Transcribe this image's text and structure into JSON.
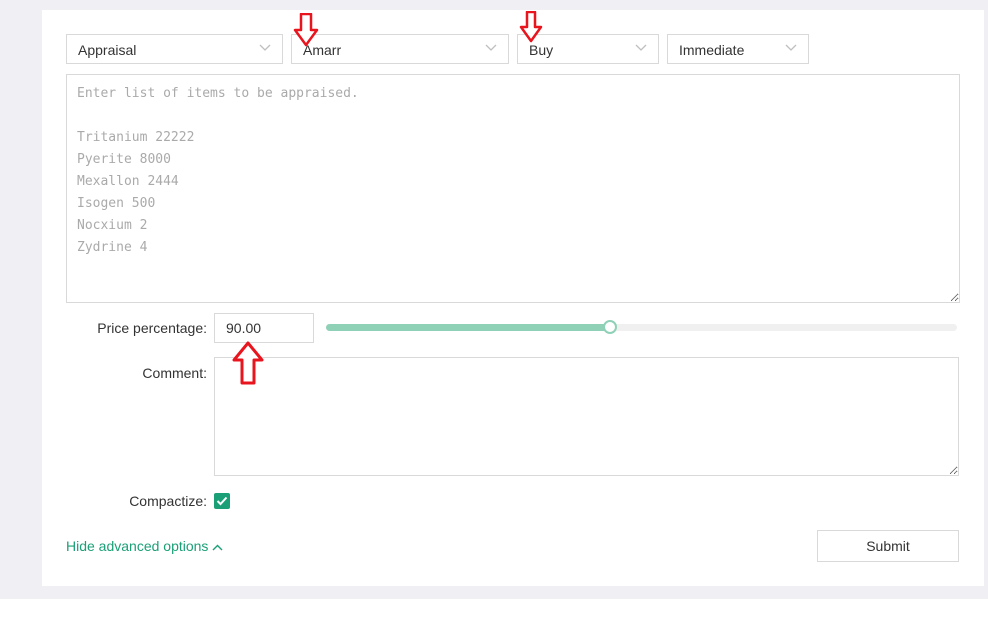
{
  "form": {
    "mode_select": {
      "value": "Appraisal"
    },
    "market_select": {
      "value": "Amarr"
    },
    "order_type_select": {
      "value": "Buy"
    },
    "timing_select": {
      "value": "Immediate"
    },
    "items_input": {
      "placeholder": "Enter list of items to be appraised.\n\nTritanium 22222\nPyerite 8000\nMexallon 2444\nIsogen 500\nNocxium 2\nZydrine 4",
      "value": ""
    },
    "price_percentage": {
      "label": "Price percentage:",
      "value": "90.00",
      "slider_fraction": 0.45
    },
    "comment": {
      "label": "Comment:",
      "value": ""
    },
    "compactize": {
      "label": "Compactize:",
      "checked": true
    },
    "advanced_toggle_label": "Hide advanced options",
    "submit_label": "Submit"
  },
  "colors": {
    "accent": "#1a9f76",
    "slider": "#8fd1b7",
    "annotation_arrow": "#e8141e",
    "page_background": "#f0f0f4"
  },
  "annotations": {
    "arrows": [
      {
        "target": "market_select",
        "direction": "down"
      },
      {
        "target": "order_type_select",
        "direction": "down"
      },
      {
        "target": "price_percentage_input",
        "direction": "up"
      }
    ]
  }
}
